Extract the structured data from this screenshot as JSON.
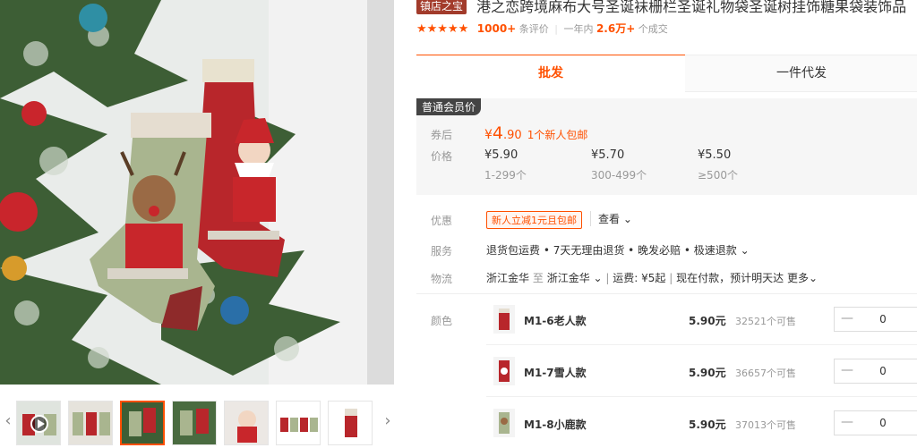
{
  "gallery": {
    "prev_arrow": "‹",
    "next_arrow": "›",
    "thumbnail_count": 7,
    "active_thumbnail": 3
  },
  "product": {
    "shop_badge": "镇店之宝",
    "title": "港之恋跨境麻布大号圣诞袜栅栏圣诞礼物袋圣诞树挂饰糖果袋装饰品",
    "stars": "★★★★★",
    "review_count": "1000+",
    "review_suffix": "条评价",
    "year_label": "一年内",
    "sold_count": "2.6万+",
    "sold_suffix": "个成交"
  },
  "tabs": {
    "wholesale": "批发",
    "dropship": "一件代发"
  },
  "pricing": {
    "member_tag": "普通会员价",
    "coupon_label": "券后",
    "coupon_currency": "¥",
    "coupon_price_int": "4",
    "coupon_price_dec": ".90",
    "coupon_note": "1个新人包邮",
    "price_label": "价格",
    "tiers": [
      {
        "price": "¥5.90",
        "range": "1-299个"
      },
      {
        "price": "¥5.70",
        "range": "300-499个"
      },
      {
        "price": "¥5.50",
        "range": "≥500个"
      }
    ]
  },
  "benefits": {
    "promo_label": "优惠",
    "promo_tag": "新人立减1元且包邮",
    "view_more": "查看 ⌄",
    "service_label": "服务",
    "service_text": "退货包运费 • 7天无理由退货 • 晚发必赔 • 极速退款 ⌄",
    "logistics_label": "物流",
    "from": "浙江金华",
    "to_word": "至",
    "to": "浙江金华 ⌄",
    "shipping": "运费: ¥5起",
    "eta": "现在付款，预计明天达",
    "more": "更多⌄"
  },
  "skus": {
    "label": "颜色",
    "items": [
      {
        "name": "M1-6老人款",
        "price": "5.90元",
        "stock": "32521个可售",
        "qty": "0",
        "minus": "—"
      },
      {
        "name": "M1-7雪人款",
        "price": "5.90元",
        "stock": "36657个可售",
        "qty": "0",
        "minus": "—"
      },
      {
        "name": "M1-8小鹿款",
        "price": "5.90元",
        "stock": "37013个可售",
        "qty": "0",
        "minus": "—"
      }
    ]
  },
  "colors": {
    "accent": "#ff5000",
    "badge": "#a23b2b"
  }
}
